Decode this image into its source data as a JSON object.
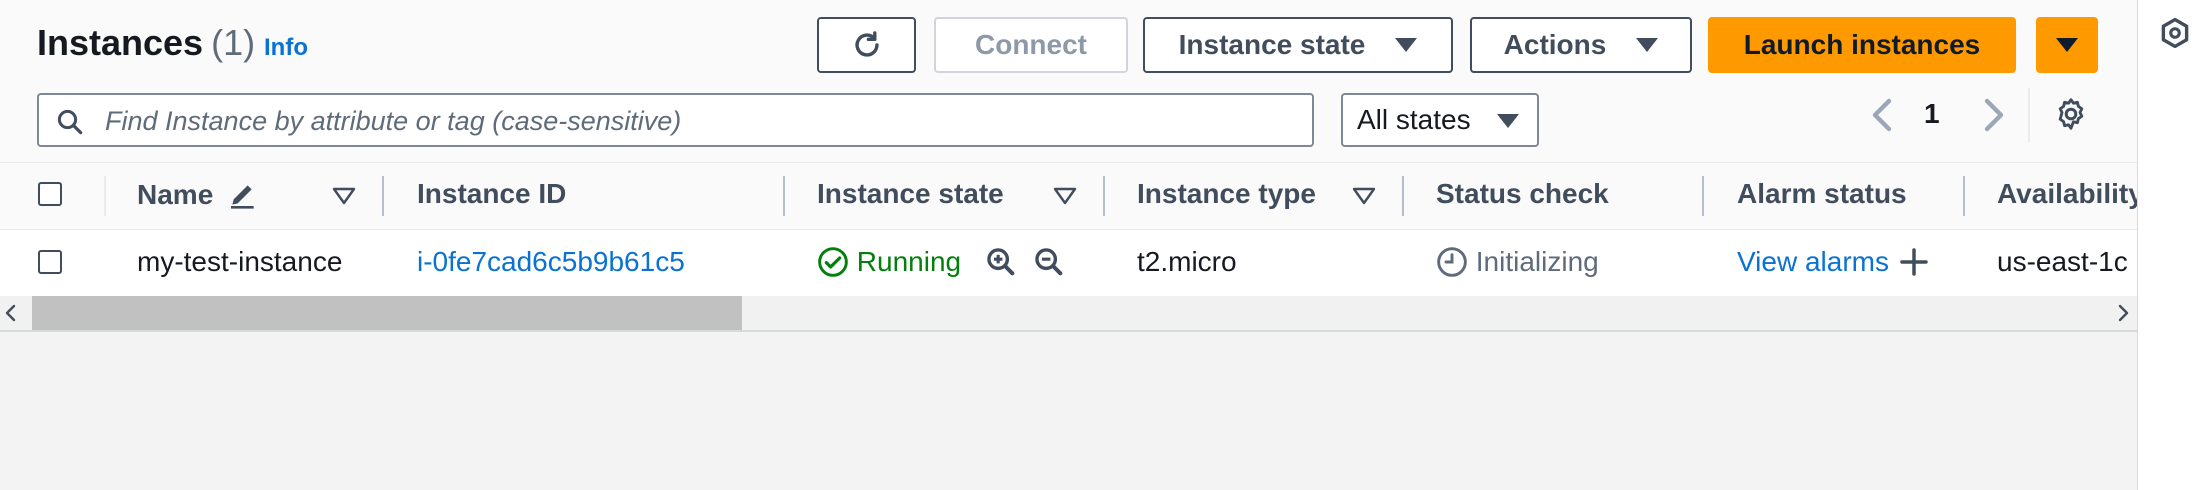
{
  "header": {
    "title": "Instances",
    "count": "(1)",
    "info": "Info"
  },
  "toolbar": {
    "connect": "Connect",
    "instance_state": "Instance state",
    "actions": "Actions",
    "launch": "Launch instances"
  },
  "search": {
    "placeholder": "Find Instance by attribute or tag (case-sensitive)",
    "value": ""
  },
  "filter": {
    "selected": "All states"
  },
  "pagination": {
    "page": "1"
  },
  "table": {
    "columns": {
      "name": "Name",
      "instance_id": "Instance ID",
      "instance_state": "Instance state",
      "instance_type": "Instance type",
      "status_check": "Status check",
      "alarm_status": "Alarm status",
      "availability": "Availability"
    },
    "rows": [
      {
        "name": "my-test-instance",
        "instance_id": "i-0fe7cad6c5b9b61c5",
        "state": "Running",
        "type": "t2.micro",
        "status": "Initializing",
        "alarm": "View alarms",
        "zone": "us-east-1c"
      }
    ]
  },
  "colors": {
    "primary": "#ff9900",
    "link": "#0972d3",
    "running": "#037f0c",
    "muted": "#5f6b7a"
  },
  "icons": [
    "refresh-icon",
    "caret-down-icon",
    "search-icon",
    "chevron-left-icon",
    "chevron-right-icon",
    "settings-icon",
    "edit-icon",
    "sort-icon",
    "check-circle-icon",
    "zoom-in-icon",
    "zoom-out-icon",
    "clock-icon",
    "plus-icon",
    "hexagon-icon"
  ]
}
